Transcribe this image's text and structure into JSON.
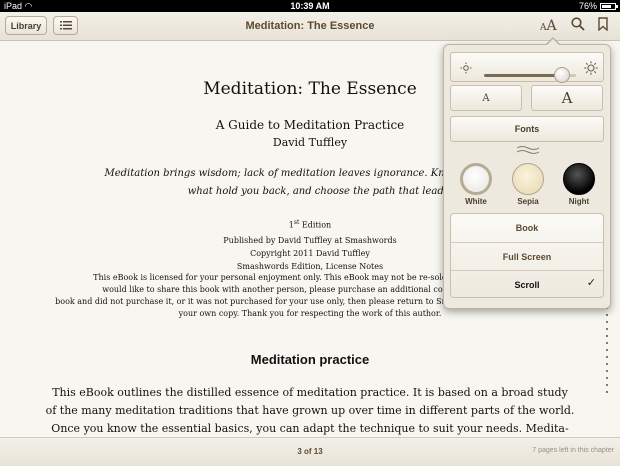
{
  "status": {
    "device": "iPad",
    "time": "10:39 AM",
    "battery": "76%",
    "battery_level": 0.76
  },
  "toolbar": {
    "library_label": "Library",
    "title": "Meditation: The Essence"
  },
  "page": {
    "book_title": "Meditation: The Essence",
    "subtitle": "A Guide to Meditation Practice",
    "author": "David Tuffley",
    "quote_line1": "Meditation brings wisdom; lack of meditation leaves ignorance. Know well what",
    "quote_line2": "what hold you back, and choose the path that leads to wisdom -- The",
    "edition_num": "1",
    "edition_sup": "st",
    "edition_word": " Edition",
    "published": "Published by David Tuffley at Smashwords",
    "copyright": "Copyright 2011 David Tuffley",
    "smash_edition": "Smashwords Edition, License Notes",
    "license": [
      "This eBook is licensed for your personal enjoyment only. This eBook may not be re-sold or given",
      "would like to share this book with another person, please purchase an additional copy for each rec",
      "book and did not purchase it, or it was not purchased for your use only, then please return to Smashwords.com and purchase",
      "your own copy. Thank you for respecting the work of this author."
    ],
    "heading": "Meditation practice",
    "body": [
      "This eBook outlines the distilled essence of meditation practice. It is based on a broad study",
      "of the many meditation traditions that have grown up over time in different parts of the world.",
      "Once you know the essential basics, you can adapt the technique to suit your needs. Medita-"
    ]
  },
  "footer": {
    "page_indicator": "3 of 13",
    "pages_left": "7 pages left in this chapter"
  },
  "popover": {
    "brightness": 0.85,
    "font_small": "A",
    "font_large": "A",
    "fonts_label": "Fonts",
    "themes": [
      {
        "label": "White",
        "color": "#ffffff",
        "selected": true
      },
      {
        "label": "Sepia",
        "color": "#f0e6c8",
        "selected": false
      },
      {
        "label": "Night",
        "color": "#111111",
        "selected": false
      }
    ],
    "modes": [
      {
        "label": "Book",
        "selected": false
      },
      {
        "label": "Full Screen",
        "selected": false
      },
      {
        "label": "Scroll",
        "selected": true
      }
    ],
    "checkmark": "✓"
  }
}
